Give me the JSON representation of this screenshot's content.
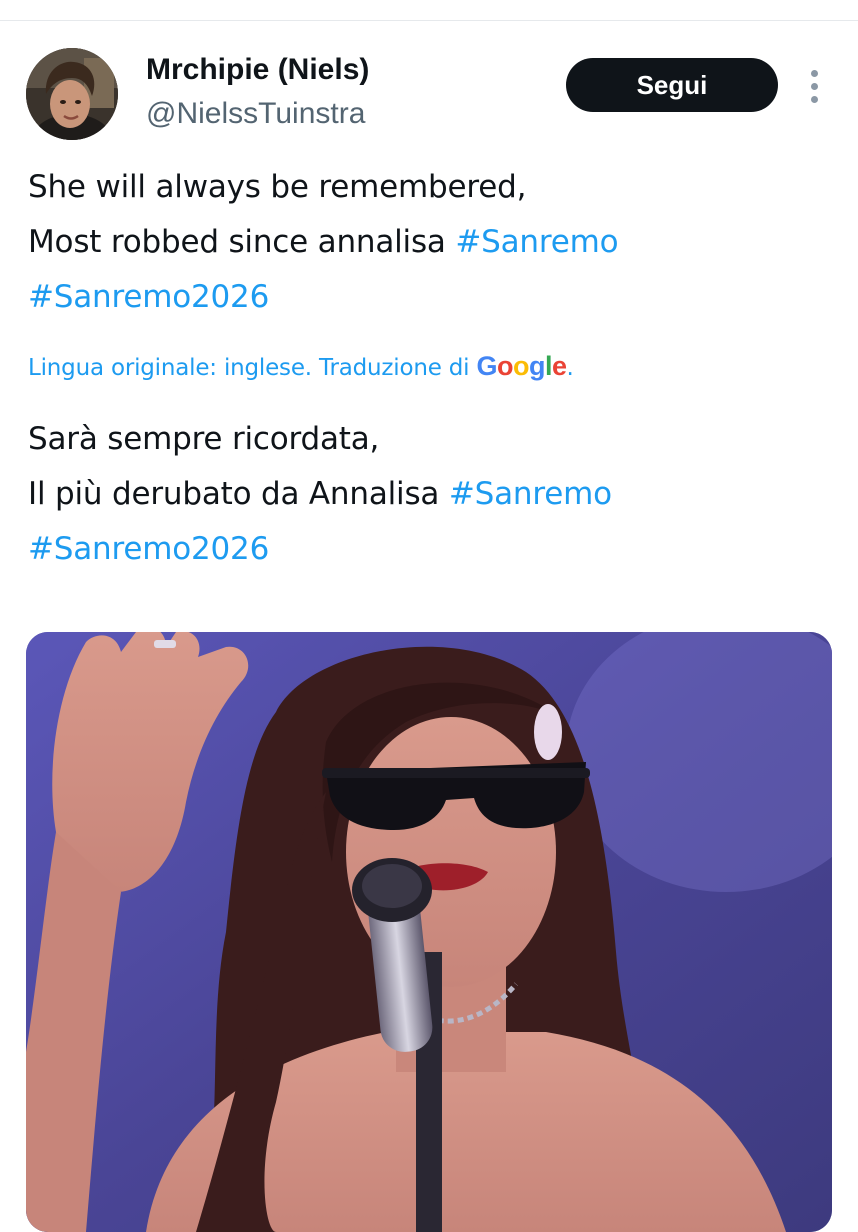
{
  "author": {
    "display_name": "Mrchipie (Niels)",
    "handle": "@NielssTuinstra",
    "avatar_icon": "avatar-photo"
  },
  "actions": {
    "follow_label": "Segui",
    "more_icon": "more-vertical-icon"
  },
  "tweet": {
    "original_lines": [
      {
        "text": "She will always be remembered,",
        "hashtag": ""
      },
      {
        "text": "Most robbed since annalisa ",
        "hashtag": "#Sanremo"
      },
      {
        "text": "",
        "hashtag": "#Sanremo2026"
      }
    ],
    "translation_note": "Lingua originale: inglese. Traduzione di ",
    "translation_provider": "Google",
    "translation_note_end": ".",
    "translated_lines": [
      {
        "text": "Sarà sempre ricordata,",
        "hashtag": ""
      },
      {
        "text": "Il più derubato da Annalisa ",
        "hashtag": "#Sanremo"
      },
      {
        "text": "",
        "hashtag": "#Sanremo2026"
      }
    ]
  },
  "media": {
    "type": "photo",
    "icon": "photo-performer-singing"
  },
  "colors": {
    "link": "#1d9bf0",
    "text": "#0f1419",
    "secondary": "#536471",
    "button_bg": "#0f1419",
    "google_blue": "#4285f4",
    "google_red": "#ea4335",
    "google_yellow": "#fbbc05",
    "google_green": "#34a853"
  }
}
